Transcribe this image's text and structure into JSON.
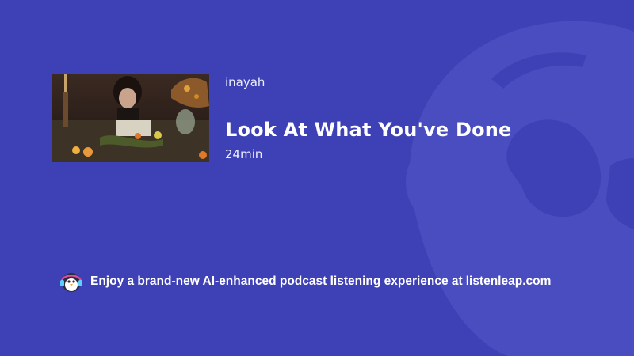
{
  "episode": {
    "author": "inayah",
    "title": "Look At What You've Done",
    "duration": "24min",
    "cover_alt": "Look At What You've Done cover art"
  },
  "promo": {
    "text": "Enjoy a brand-new AI-enhanced podcast listening experience at",
    "link_text": "listenleap.com",
    "logo_icon": "penguin-headphones-icon"
  },
  "colors": {
    "background": "#3e40b5",
    "mascot_shade": "#4a4dbf",
    "text": "#ffffff"
  }
}
